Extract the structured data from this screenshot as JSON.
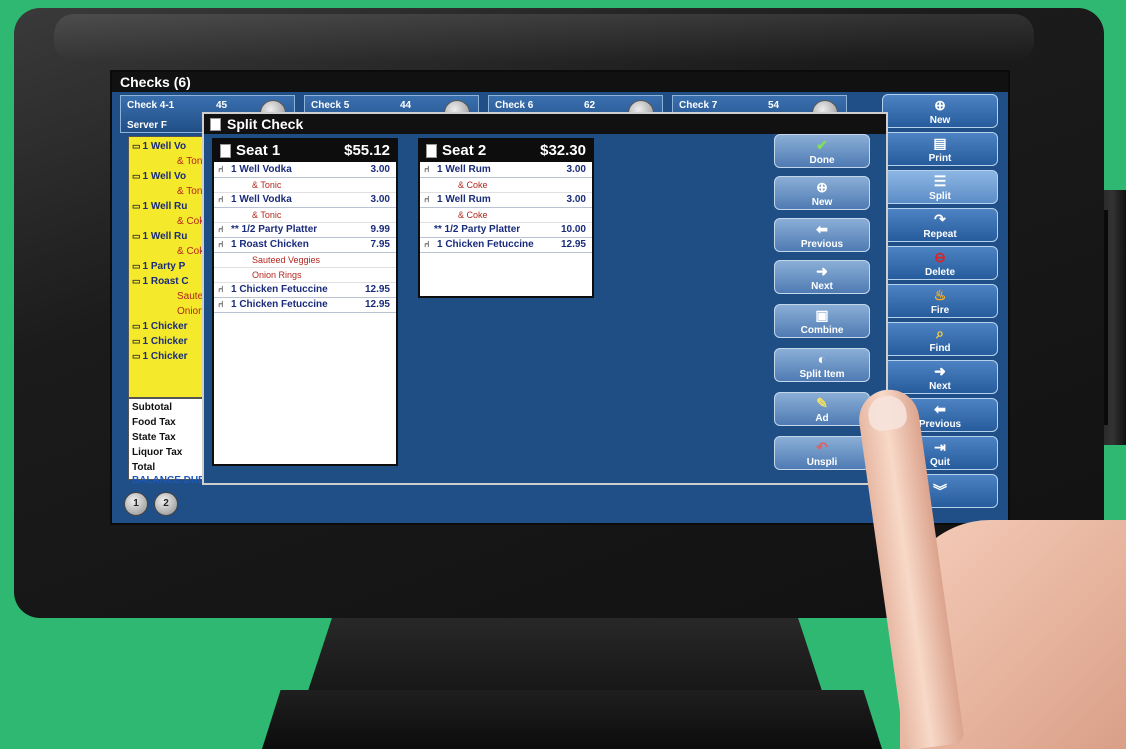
{
  "screen": {
    "title": "Checks (6)"
  },
  "checks": [
    {
      "name": "Check 4-1",
      "number": "45",
      "server": "Server F"
    },
    {
      "name": "Check 5",
      "number": "44",
      "server": ""
    },
    {
      "name": "Check 6",
      "number": "62",
      "server": ""
    },
    {
      "name": "Check 7",
      "number": "54",
      "server": ""
    }
  ],
  "background_check": {
    "rows": [
      "1 Well Vo",
      "& Toni",
      "1 Well Vo",
      "& Toni",
      "1 Well Ru",
      "& Coke",
      "1 Well Ru",
      "& Coke",
      "1 Party P",
      "1 Roast C",
      "Sautee",
      "Onion",
      "1 Chicker",
      "1 Chicker",
      "1 Chicker"
    ],
    "totals": [
      "Subtotal",
      "Food Tax",
      "State Tax",
      "Liquor Tax",
      "Total",
      "BALANCE DUE"
    ]
  },
  "seat_tabs": [
    "1",
    "2"
  ],
  "main_buttons": [
    {
      "label": "New",
      "icon": "plus-icon"
    },
    {
      "label": "Print",
      "icon": "printer-icon"
    },
    {
      "label": "Split",
      "icon": "split-list-icon"
    },
    {
      "label": "Repeat",
      "icon": "repeat-arrow-icon"
    },
    {
      "label": "Delete",
      "icon": "minus-icon"
    },
    {
      "label": "Fire",
      "icon": "flame-icon"
    },
    {
      "label": "Find",
      "icon": "magnifier-icon"
    },
    {
      "label": "Next",
      "icon": "right-arrow-icon"
    },
    {
      "label": "Previous",
      "icon": "left-arrow-icon"
    },
    {
      "label": "Quit",
      "icon": "exit-icon"
    },
    {
      "label": "",
      "icon": "double-chevron-down-icon"
    }
  ],
  "split_check": {
    "title": "Split Check",
    "seats": [
      {
        "name": "Seat 1",
        "total": "$55.12",
        "items": [
          {
            "name": "1 Well Vodka",
            "price": "3.00",
            "chair": true
          },
          {
            "mod": "& Tonic"
          },
          {
            "name": "1 Well Vodka",
            "price": "3.00",
            "chair": true
          },
          {
            "mod": "& Tonic"
          },
          {
            "name": "** 1/2 Party Platter",
            "price": "9.99",
            "chair": true
          },
          {
            "name": "1 Roast Chicken",
            "price": "7.95",
            "chair": true
          },
          {
            "mod": "Sauteed Veggies"
          },
          {
            "mod": "Onion Rings"
          },
          {
            "name": "1 Chicken Fetuccine",
            "price": "12.95",
            "chair": true
          },
          {
            "name": "1 Chicken Fetuccine",
            "price": "12.95",
            "chair": true
          }
        ]
      },
      {
        "name": "Seat 2",
        "total": "$32.30",
        "items": [
          {
            "name": "1 Well Rum",
            "price": "3.00",
            "chair": true
          },
          {
            "mod": "& Coke"
          },
          {
            "name": "1 Well Rum",
            "price": "3.00",
            "chair": true
          },
          {
            "mod": "& Coke"
          },
          {
            "name": "** 1/2 Party Platter",
            "price": "10.00",
            "chair": false
          },
          {
            "name": "1 Chicken Fetuccine",
            "price": "12.95",
            "chair": true
          }
        ]
      }
    ],
    "buttons": [
      {
        "label": "Done",
        "icon": "checkmark-icon"
      },
      {
        "label": "New",
        "icon": "plus-icon"
      },
      {
        "label": "Previous",
        "icon": "left-arrow-icon"
      },
      {
        "label": "Next",
        "icon": "right-arrow-icon"
      },
      {
        "label": "Combine",
        "icon": "combine-icon"
      },
      {
        "label": "Split Item",
        "icon": "half-circle-icon"
      },
      {
        "label": "Ad",
        "icon": "pencil-icon"
      },
      {
        "label": "Unspli",
        "icon": "undo-icon"
      }
    ]
  },
  "colors": {
    "background": "#2fb872",
    "screen_blue": "#1f4f86",
    "check_yellow": "#f4e92a",
    "item_text": "#1a2b7a",
    "modifier_text": "#b3261e"
  }
}
